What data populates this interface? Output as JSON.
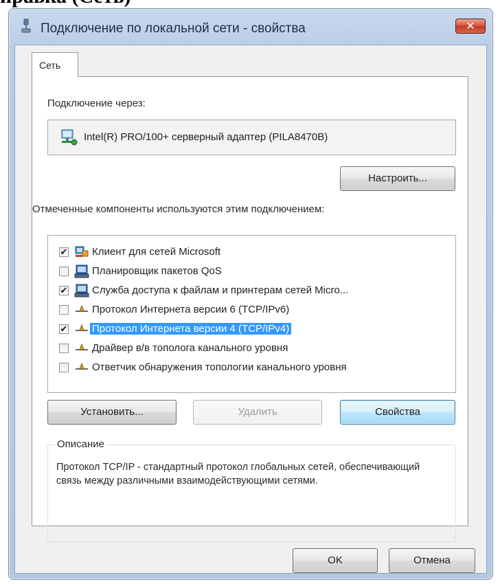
{
  "page_heading_fragment": "правка (Сеть)",
  "window": {
    "title": "Подключение по локальной сети - свойства",
    "close_glyph": "✕"
  },
  "tabs": [
    {
      "label": "Сеть",
      "selected": true
    }
  ],
  "connect_via": {
    "label": "Подключение через:",
    "adapter_name": "Intel(R) PRO/100+ серверный адаптер (PILA8470B)",
    "configure_button": "Настроить..."
  },
  "components": {
    "label": "Отмеченные компоненты используются этим подключением:",
    "items": [
      {
        "label": "Клиент для сетей Microsoft",
        "checked": true,
        "icon": "network-client-icon",
        "selected": false
      },
      {
        "label": "Планировщик пакетов QoS",
        "checked": false,
        "icon": "network-service-icon",
        "selected": false
      },
      {
        "label": "Служба доступа к файлам и принтерам сетей Micro...",
        "checked": true,
        "icon": "network-service-icon",
        "selected": false
      },
      {
        "label": "Протокол Интернета версии 6 (TCP/IPv6)",
        "checked": false,
        "icon": "network-protocol-icon",
        "selected": false
      },
      {
        "label": "Протокол Интернета версии 4 (TCP/IPv4)",
        "checked": true,
        "icon": "network-protocol-icon",
        "selected": true
      },
      {
        "label": "Драйвер в/в тополога канального уровня",
        "checked": false,
        "icon": "network-protocol-icon",
        "selected": false
      },
      {
        "label": "Ответчик обнаружения топологии канального уровня",
        "checked": false,
        "icon": "network-protocol-icon",
        "selected": false
      }
    ]
  },
  "actions": {
    "install": "Установить...",
    "remove": "Удалить",
    "properties": "Свойства"
  },
  "description": {
    "title": "Описание",
    "text": "Протокол TCP/IP - стандартный протокол глобальных сетей, обеспечивающий связь между различными взаимодействующими сетями."
  },
  "footer": {
    "ok": "OK",
    "cancel": "Отмена"
  },
  "colors": {
    "selection": "#3399ff",
    "title_bar": "#b9cde6",
    "close_button": "#c23a22"
  }
}
